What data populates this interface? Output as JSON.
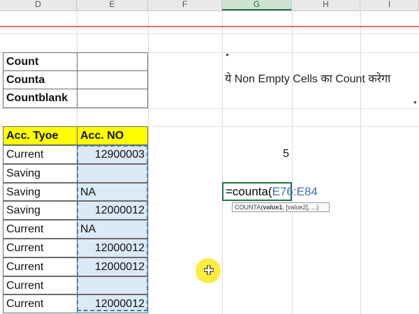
{
  "columns": [
    "D",
    "E",
    "F",
    "G",
    "H",
    "I"
  ],
  "selected_column": "G",
  "summary_labels": [
    "Count",
    "Counta",
    "Countblank"
  ],
  "table": {
    "headers": [
      "Acc. Tyoe",
      "Acc. NO"
    ],
    "rows": [
      [
        "Current",
        "12900003"
      ],
      [
        "Saving",
        ""
      ],
      [
        "Saving",
        "NA"
      ],
      [
        "Saving",
        "12000012"
      ],
      [
        "Current",
        "NA"
      ],
      [
        "Current",
        "12000012"
      ],
      [
        "Current",
        "12000012"
      ],
      [
        "Current",
        ""
      ],
      [
        "Current",
        "12000012"
      ]
    ]
  },
  "note_text": "ये Non Empty Cells का Count करेगा",
  "result_value": "5",
  "formula": {
    "prefix": "=counta(",
    "range": "E76:E84"
  },
  "tooltip": {
    "fn": "COUNTA(",
    "arg1": "value1",
    "rest": ", [value2], ...)"
  },
  "colors": {
    "header_fill": "#ffff00",
    "marquee": "#3b7bbf",
    "active_cell_border": "#217346",
    "reference_text": "#3b6fb6"
  }
}
